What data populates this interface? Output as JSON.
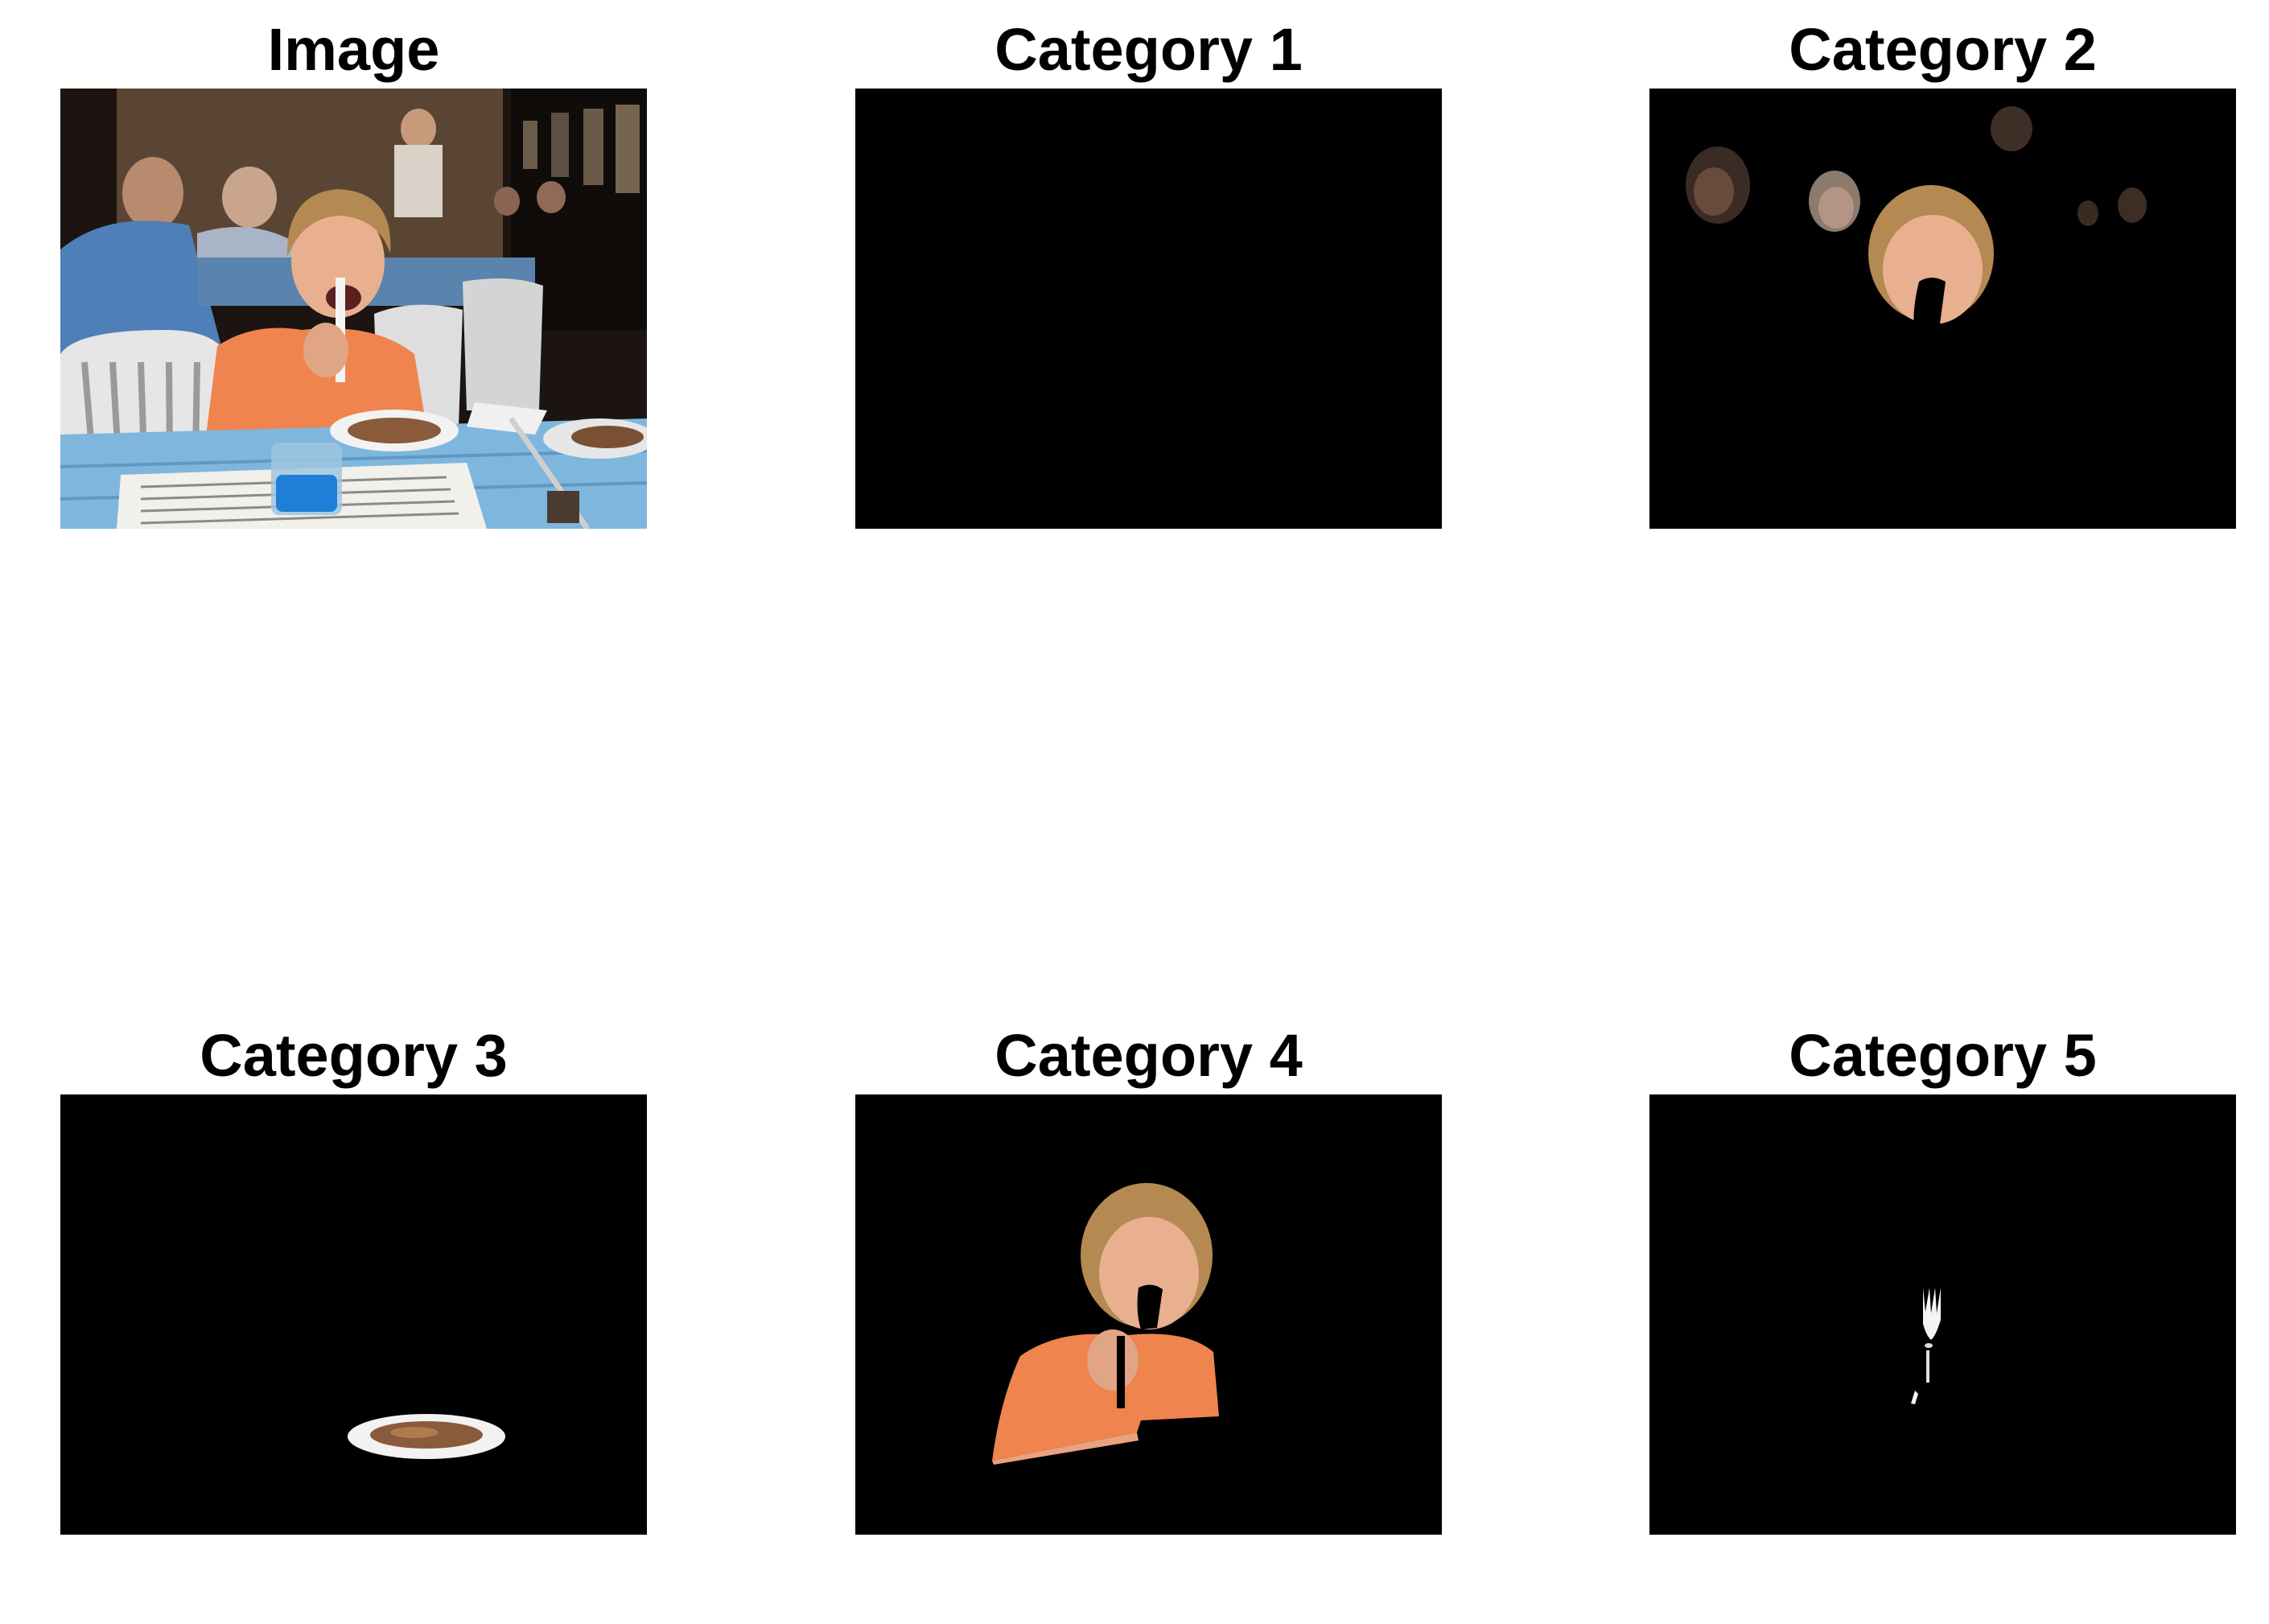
{
  "panels": [
    {
      "title": "Image"
    },
    {
      "title": "Category 1"
    },
    {
      "title": "Category 2"
    },
    {
      "title": "Category 3"
    },
    {
      "title": "Category 4"
    },
    {
      "title": "Category 5"
    }
  ],
  "colors": {
    "background": "#ffffff",
    "mask": "#000000",
    "skin": "#e9b08f",
    "hair": "#b48a52",
    "shirt_orange": "#f0844f",
    "tablecloth": "#7fb6dd",
    "chair_white": "#e6e6e6",
    "plate_white": "#f2f2f2",
    "food_brown": "#8a5a3a"
  }
}
